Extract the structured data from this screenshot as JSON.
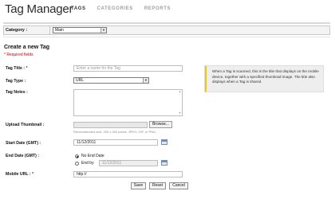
{
  "app": {
    "title": "Tag Manager"
  },
  "nav": {
    "tabs": [
      {
        "label": "TAGS",
        "active": true
      },
      {
        "label": "CATEGORIES",
        "active": false
      },
      {
        "label": "REPORTS",
        "active": false
      }
    ]
  },
  "category": {
    "label": "Category :",
    "selected": "Main"
  },
  "form": {
    "section_title": "Create a new Tag",
    "required_note": "* Required fields",
    "tag_title": {
      "label": "Tag Title :",
      "required_mark": "*",
      "placeholder": "Enter a name for the Tag",
      "value": ""
    },
    "tag_type": {
      "label": "Tag Type :",
      "selected": "URL"
    },
    "tag_notes": {
      "label": "Tag Notes :",
      "value": ""
    },
    "upload": {
      "label": "Upload Thumbnail :",
      "button_label": "Browse...",
      "hint": "Recommended size: 200 x 200 pixels. JPEG, GIF, or PNG."
    },
    "start_date": {
      "label": "Start Date (GMT) :",
      "value": "11/12/2011"
    },
    "end_date": {
      "label": "End Date (GMT) :",
      "options": [
        {
          "label": "No End Date",
          "checked": true
        },
        {
          "label": "End by",
          "checked": false,
          "value": "11/12/2011"
        }
      ]
    },
    "mobile_url": {
      "label": "Mobile URL :",
      "required_mark": "*",
      "value": "http://"
    },
    "buttons": {
      "save": "Save",
      "reset": "Reset",
      "cancel": "Cancel"
    }
  },
  "tooltip": {
    "text": "When a Tag is scanned, this is the title that displays on the mobile device, together with a specified thumbnail image. The title also displays when a Tag is shared."
  },
  "colors": {
    "accent_bar": "#f0c419",
    "required": "#cc0000",
    "tooltip_bg": "#eeeeee"
  }
}
